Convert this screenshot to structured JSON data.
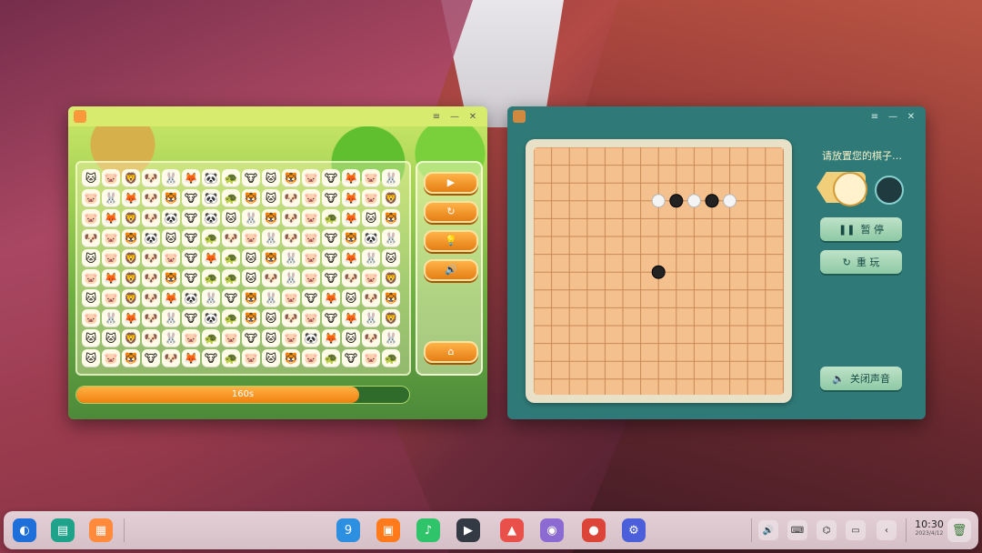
{
  "link_game": {
    "window_controls": {
      "menu": "≡",
      "minimize": "—",
      "close": "✕"
    },
    "side_buttons": [
      {
        "icon": "play-icon",
        "glyph": "▶"
      },
      {
        "icon": "refresh-icon",
        "glyph": "↻"
      },
      {
        "icon": "hint-icon",
        "glyph": "💡"
      },
      {
        "icon": "sound-icon",
        "glyph": "🔊"
      },
      {
        "icon": "home-icon",
        "glyph": "⌂"
      }
    ],
    "progress": {
      "label": "160s",
      "fraction": 0.85
    },
    "tiles": [
      "🐱",
      "🐷",
      "🦁",
      "🐶",
      "🐰",
      "🦊",
      "🐼",
      "🐢",
      "🐮",
      "🐱",
      "🐯",
      "🐷",
      "🐮",
      "🦊",
      "🐷",
      "🐰",
      "🐷",
      "🐰",
      "🦊",
      "🐶",
      "🐯",
      "🐮",
      "🐼",
      "🐢",
      "🐯",
      "🐱",
      "🐶",
      "🐷",
      "🐮",
      "🦊",
      "🐷",
      "🦁",
      "🐷",
      "🦊",
      "🦁",
      "🐶",
      "🐼",
      "🐮",
      "🐼",
      "🐱",
      "🐰",
      "🐯",
      "🐶",
      "🐷",
      "🐢",
      "🦊",
      "🐱",
      "🐯",
      "🐶",
      "🐷",
      "🐯",
      "🐼",
      "🐱",
      "🐮",
      "🐢",
      "🐶",
      "🐷",
      "🐰",
      "🐶",
      "🐷",
      "🐮",
      "🐯",
      "🐼",
      "🐰",
      "🐱",
      "🐷",
      "🦁",
      "🐶",
      "🐷",
      "🐮",
      "🦊",
      "🐢",
      "🐱",
      "🐯",
      "🐰",
      "🐷",
      "🐮",
      "🦊",
      "🐰",
      "🐱",
      "🐷",
      "🦊",
      "🦁",
      "🐶",
      "🐯",
      "🐮",
      "🐢",
      "🐢",
      "🐱",
      "🐶",
      "🐰",
      "🐷",
      "🐮",
      "🐶",
      "🐷",
      "🦁",
      "🐱",
      "🐷",
      "🦁",
      "🐶",
      "🦊",
      "🐼",
      "🐰",
      "🐮",
      "🐯",
      "🐰",
      "🐷",
      "🐮",
      "🦊",
      "🐱",
      "🐶",
      "🐯",
      "🐷",
      "🐰",
      "🦊",
      "🐶",
      "🐰",
      "🐮",
      "🐼",
      "🐢",
      "🐯",
      "🐱",
      "🐶",
      "🐷",
      "🐮",
      "🦊",
      "🐰",
      "🦁",
      "🐱",
      "🐱",
      "🦁",
      "🐶",
      "🐰",
      "🐷",
      "🐢",
      "🐷",
      "🐮",
      "🐱",
      "🐷",
      "🐼",
      "🦊",
      "🐱",
      "🐶",
      "🐰",
      "🐱",
      "🐷",
      "🐯",
      "🐮",
      "🐶",
      "🦊",
      "🐮",
      "🐢",
      "🐷",
      "🐱",
      "🐯",
      "🐷",
      "🐢",
      "🐮",
      "🐷",
      "🐢"
    ]
  },
  "gomoku": {
    "window_controls": {
      "menu": "≡",
      "minimize": "—",
      "close": "✕"
    },
    "status_text": "请放置您的棋子…",
    "pause_label": "暂 停",
    "restart_label": "重 玩",
    "mute_label": "关闭声音",
    "stones": [
      {
        "color": "white",
        "col": 7,
        "row": 3
      },
      {
        "color": "black",
        "col": 8,
        "row": 3
      },
      {
        "color": "white",
        "col": 9,
        "row": 3
      },
      {
        "color": "black",
        "col": 10,
        "row": 3
      },
      {
        "color": "white",
        "col": 11,
        "row": 3
      },
      {
        "color": "black",
        "col": 7,
        "row": 7
      }
    ],
    "colors": {
      "board": "#f3c08e",
      "window": "#2f7a78"
    }
  },
  "taskbar": {
    "left_apps": [
      {
        "name": "launcher-icon",
        "glyph": "◐",
        "color": "#1e6fd9"
      },
      {
        "name": "multitask-icon",
        "glyph": "▤",
        "color": "#1ea38a"
      },
      {
        "name": "workspace-icon",
        "glyph": "▦",
        "color": "#ff8a3c"
      }
    ],
    "center_apps": [
      {
        "name": "file-manager-icon",
        "glyph": "9",
        "color": "#2d8fe0"
      },
      {
        "name": "app-store-icon",
        "glyph": "▣",
        "color": "#ff7a1a"
      },
      {
        "name": "music-icon",
        "glyph": "♪",
        "color": "#2fc46a"
      },
      {
        "name": "video-icon",
        "glyph": "▶",
        "color": "#333a44"
      },
      {
        "name": "photos-icon",
        "glyph": "▲",
        "color": "#e9504a"
      },
      {
        "name": "camera-icon",
        "glyph": "◉",
        "color": "#8b6bd1"
      },
      {
        "name": "chrome-icon",
        "glyph": "●",
        "color": "#db4437"
      },
      {
        "name": "settings-icon",
        "glyph": "⚙",
        "color": "#4a5fd9"
      }
    ],
    "tray": [
      {
        "name": "volume-icon",
        "glyph": "🔊"
      },
      {
        "name": "keyboard-icon",
        "glyph": "⌨"
      },
      {
        "name": "wifi-icon",
        "glyph": "⌬"
      },
      {
        "name": "battery-icon",
        "glyph": "▭"
      },
      {
        "name": "collapse-icon",
        "glyph": "‹"
      }
    ],
    "clock": {
      "time": "10:30",
      "date": "2023/4/12"
    },
    "trash_glyph": "🗑"
  }
}
